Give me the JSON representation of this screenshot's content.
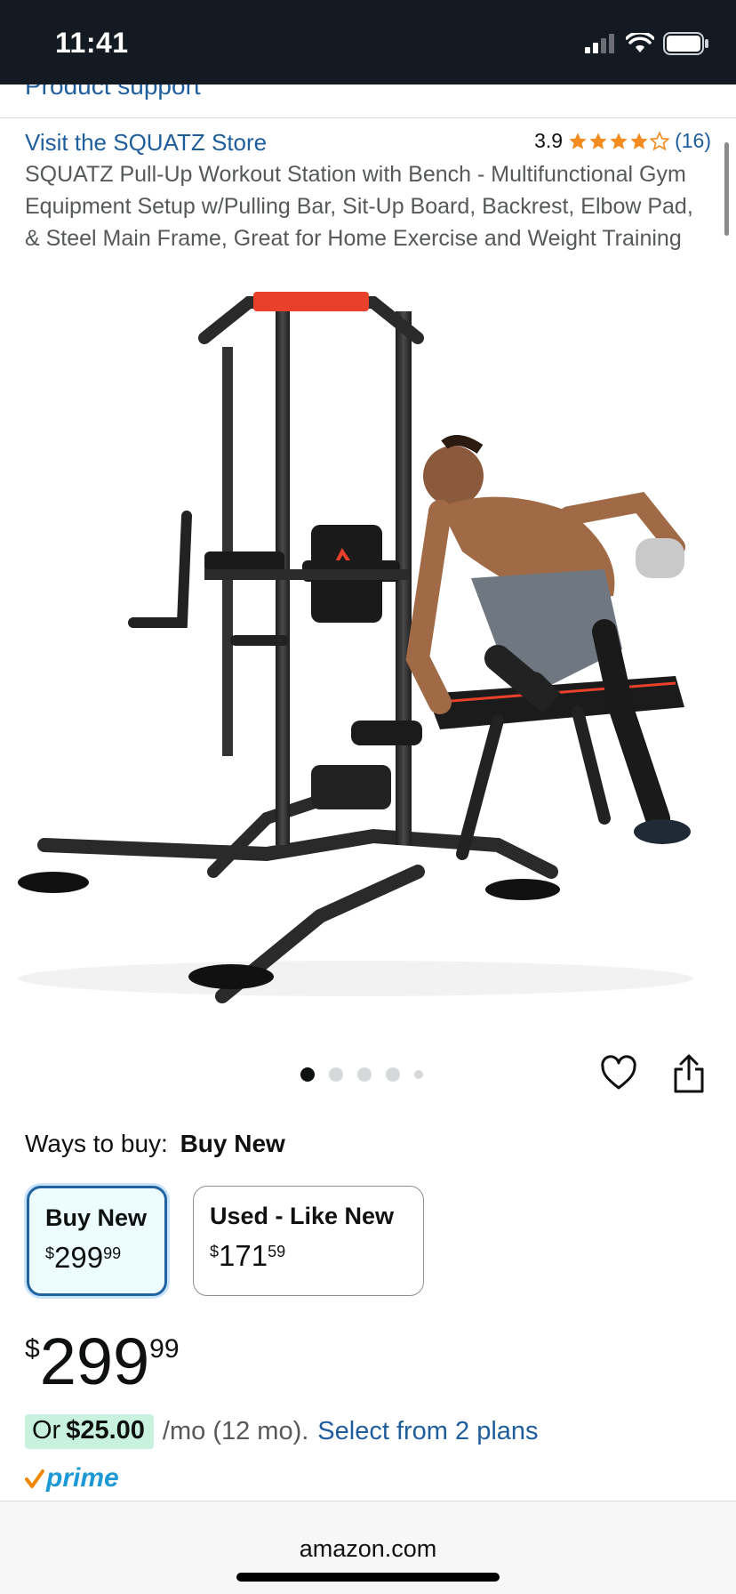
{
  "status_bar": {
    "time": "11:41"
  },
  "support": {
    "link_text": "Product support"
  },
  "store": {
    "link_text": "Visit the SQUATZ Store"
  },
  "rating": {
    "value": "3.9",
    "count": "(16)",
    "stars": 3.9,
    "star_color": "#f38b1f"
  },
  "product": {
    "title": "SQUATZ Pull-Up Workout Station with Bench - Multifunctional Gym Equipment Setup w/Pulling Bar, Sit-Up Board, Backrest, Elbow Pad, & Steel Main Frame, Great for Home Exercise and Weight Training"
  },
  "gallery": {
    "count": 5,
    "active_index": 0
  },
  "ways_to_buy": {
    "label": "Ways to buy:",
    "value": "Buy New"
  },
  "options": [
    {
      "label": "Buy New",
      "currency": "$",
      "whole": "299",
      "fraction": "99",
      "selected": true
    },
    {
      "label": "Used - Like New",
      "currency": "$",
      "whole": "171",
      "fraction": "59",
      "selected": false
    }
  ],
  "price": {
    "currency": "$",
    "whole": "299",
    "fraction": "99"
  },
  "installment": {
    "prefix": "Or",
    "amount": "$25.00",
    "term": "/mo (12 mo).",
    "link": "Select from 2 plans",
    "highlight_color": "#c8f1e0"
  },
  "prime": {
    "label": "prime",
    "color": "#1d9ad6",
    "check_color": "#f08804"
  },
  "browser": {
    "domain": "amazon.com"
  },
  "colors": {
    "link": "#1f5e9c",
    "selected_border": "#2162a1",
    "status_bar": "#131a22"
  }
}
